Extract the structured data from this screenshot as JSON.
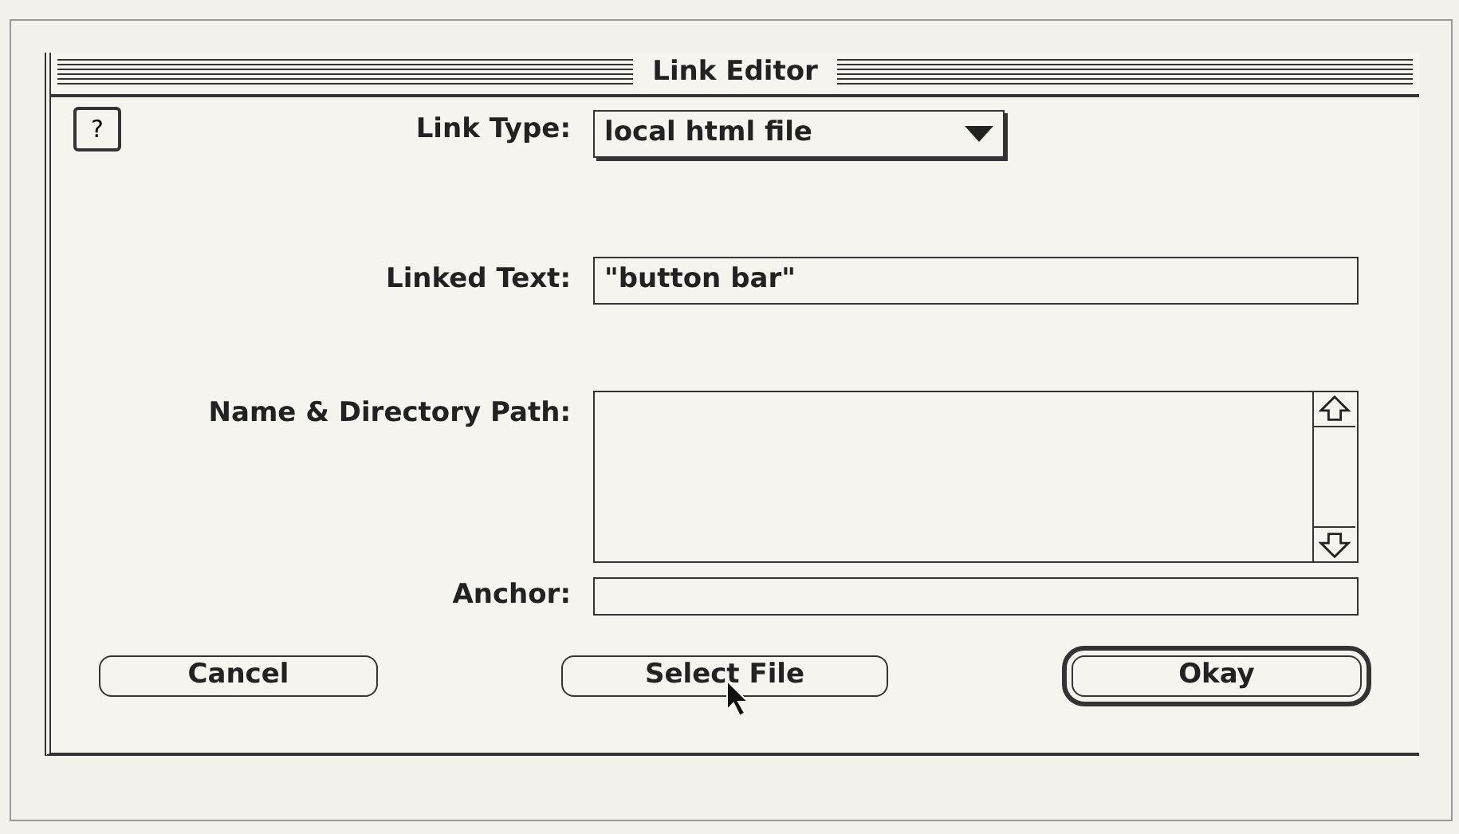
{
  "window": {
    "title": "Link Editor"
  },
  "help_button": {
    "label": "?"
  },
  "link_type": {
    "label": "Link Type:",
    "value": "local html file"
  },
  "linked_text": {
    "label": "Linked Text:",
    "value": "\"button bar\""
  },
  "path": {
    "label": "Name & Directory Path:"
  },
  "anchor": {
    "label": "Anchor:"
  },
  "buttons": [
    {
      "label": "Cancel",
      "kind": "plain"
    },
    {
      "label": "Select File",
      "kind": "plain"
    },
    {
      "label": "Okay",
      "kind": "default"
    }
  ]
}
